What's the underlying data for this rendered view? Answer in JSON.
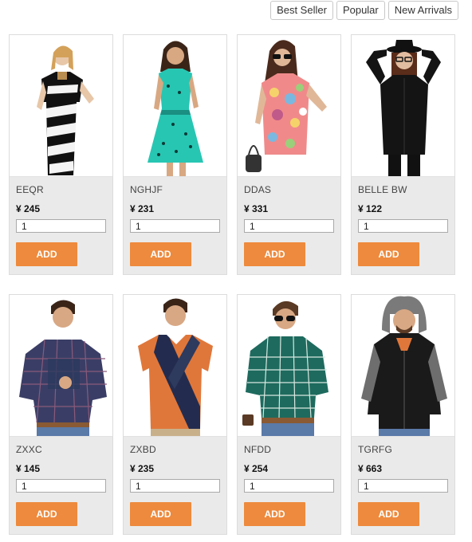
{
  "sort": {
    "best_seller": "Best Seller",
    "popular": "Popular",
    "new_arrivals": "New Arrivals"
  },
  "products": [
    {
      "name": "EEQR",
      "price": "¥ 245",
      "qty": "1",
      "add_label": "ADD",
      "image": "woman-black-white-striped-dress"
    },
    {
      "name": "NGHJF",
      "price": "¥ 231",
      "qty": "1",
      "add_label": "ADD",
      "image": "woman-teal-print-dress"
    },
    {
      "name": "DDAS",
      "price": "¥ 331",
      "qty": "1",
      "add_label": "ADD",
      "image": "woman-floral-top-sunglasses"
    },
    {
      "name": "BELLE BW",
      "price": "¥ 122",
      "qty": "1",
      "add_label": "ADD",
      "image": "woman-black-shirt-hat"
    },
    {
      "name": "ZXXC",
      "price": "¥ 145",
      "qty": "1",
      "add_label": "ADD",
      "image": "man-navy-plaid-shirt"
    },
    {
      "name": "ZXBD",
      "price": "¥ 235",
      "qty": "1",
      "add_label": "ADD",
      "image": "man-orange-navy-polo"
    },
    {
      "name": "NFDD",
      "price": "¥ 254",
      "qty": "1",
      "add_label": "ADD",
      "image": "man-green-check-shirt"
    },
    {
      "name": "TGRFG",
      "price": "¥ 663",
      "qty": "1",
      "add_label": "ADD",
      "image": "man-black-grey-hoodie"
    }
  ],
  "colors": {
    "accent": "#ee8a3d",
    "card_bg": "#eaeaea"
  }
}
